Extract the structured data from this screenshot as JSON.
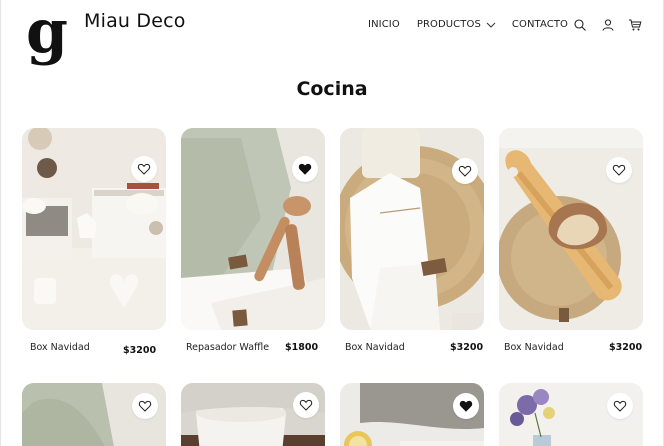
{
  "brand": {
    "name": "Miau Deco",
    "logo_letter": "g"
  },
  "nav": {
    "items": [
      {
        "label": "INICIO"
      },
      {
        "label": "PRODUCTOS"
      },
      {
        "label": "CONTACTO"
      }
    ],
    "icons": [
      "search-icon",
      "user-icon",
      "cart-icon"
    ]
  },
  "page": {
    "title": "Cocina"
  },
  "products": [
    {
      "name": "Box Navidad",
      "price": "$3200",
      "favorited": false
    },
    {
      "name": "Repasador Waffle",
      "price": "$1800",
      "favorited": true
    },
    {
      "name": "Box Navidad",
      "price": "$3200",
      "favorited": false
    },
    {
      "name": "Box Navidad",
      "price": "$3200",
      "favorited": false
    },
    {
      "favorited": false
    },
    {
      "favorited": false
    },
    {
      "favorited": true
    },
    {
      "favorited": false
    }
  ],
  "colors": {
    "text": "#111111",
    "heart_filled": "#111111",
    "background": "#ffffff"
  }
}
